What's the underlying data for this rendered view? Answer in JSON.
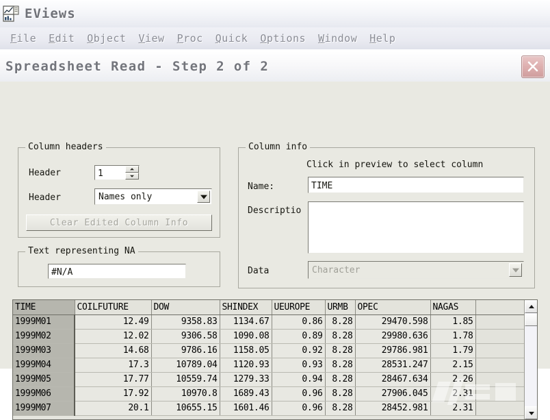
{
  "app": {
    "icon": "eviews-chart-icon",
    "title": "EViews",
    "menu": [
      {
        "label": "File",
        "accel": "F"
      },
      {
        "label": "Edit",
        "accel": "E"
      },
      {
        "label": "Object",
        "accel": "O"
      },
      {
        "label": "View",
        "accel": "V"
      },
      {
        "label": "Proc",
        "accel": "P"
      },
      {
        "label": "Quick",
        "accel": "Q"
      },
      {
        "label": "Options",
        "accel": "O"
      },
      {
        "label": "Window",
        "accel": "W"
      },
      {
        "label": "Help",
        "accel": "H"
      }
    ]
  },
  "dialog": {
    "title": "Spreadsheet Read - Step 2 of 2",
    "close_icon": "close-x-icon",
    "close_color": "#d7a9a9",
    "column_headers": {
      "legend": "Column headers",
      "header_count_label": "Header",
      "header_count_value": "1",
      "header_type_label": "Header",
      "header_type_value": "Names only",
      "header_type_options": [
        "Names only"
      ],
      "clear_button_label": "Clear Edited Column Info",
      "clear_button_accel": "l",
      "clear_button_enabled": false
    },
    "text_na": {
      "legend": "Text representing NA",
      "value": "#N/A"
    },
    "column_info": {
      "legend": "Column info",
      "hint": "Click in preview to select column",
      "name_label": "Name:",
      "name_value": "TIME",
      "description_label": "Descriptio",
      "description_value": "",
      "data_label": "Data",
      "data_value": "Character",
      "data_options": [
        "Character"
      ],
      "data_enabled": false
    }
  },
  "preview": {
    "columns": [
      "TIME",
      "COILFUTURE",
      "DOW",
      "SHINDEX",
      "UEUROPE",
      "URMB",
      "OPEC",
      "NAGAS",
      ""
    ],
    "rows": [
      [
        "1999M01",
        "12.49",
        "9358.83",
        "1134.67",
        "0.86",
        "8.28",
        "29470.598",
        "1.85",
        ""
      ],
      [
        "1999M02",
        "12.02",
        "9306.58",
        "1090.08",
        "0.89",
        "8.28",
        "29980.636",
        "1.78",
        ""
      ],
      [
        "1999M03",
        "14.68",
        "9786.16",
        "1158.05",
        "0.92",
        "8.28",
        "29786.981",
        "1.79",
        ""
      ],
      [
        "1999M04",
        "17.3",
        "10789.04",
        "1120.93",
        "0.93",
        "8.28",
        "28531.247",
        "2.15",
        ""
      ],
      [
        "1999M05",
        "17.77",
        "10559.74",
        "1279.33",
        "0.94",
        "8.28",
        "28467.634",
        "2.26",
        ""
      ],
      [
        "1999M06",
        "17.92",
        "10970.8",
        "1689.43",
        "0.96",
        "8.28",
        "27906.045",
        "2.31",
        ""
      ],
      [
        "1999M07",
        "20.1",
        "10655.15",
        "1601.46",
        "0.96",
        "8.28",
        "28452.981",
        "2.31",
        ""
      ]
    ],
    "scrollbar": {
      "up_icon": "chevron-up-icon",
      "down_icon": "chevron-down-icon"
    }
  }
}
